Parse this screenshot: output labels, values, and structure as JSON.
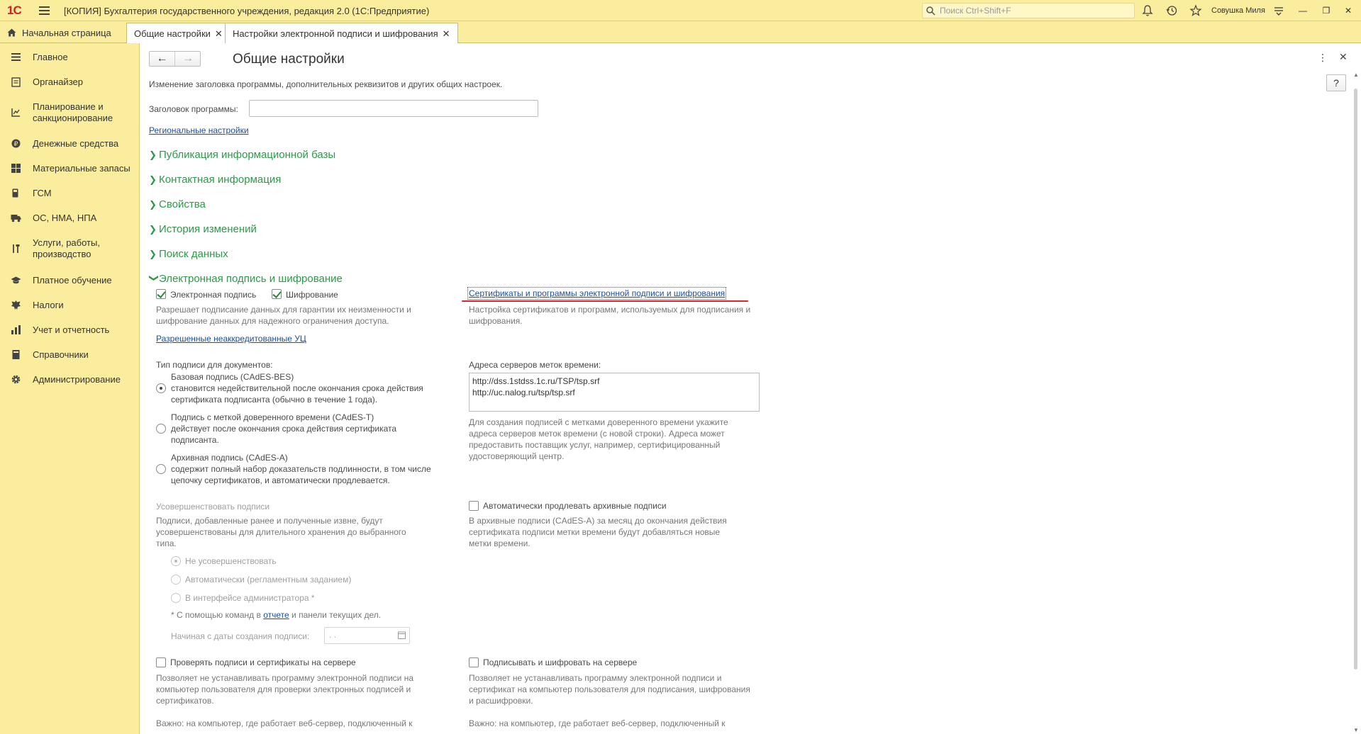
{
  "app": {
    "logo": "1С",
    "title": "[КОПИЯ] Бухгалтерия государственного учреждения, редакция 2.0  (1С:Предприятие)",
    "search_placeholder": "Поиск Ctrl+Shift+F",
    "user_name": "Совушка Миля"
  },
  "tabs": [
    {
      "label": "Начальная страница"
    },
    {
      "label": "Общие настройки"
    },
    {
      "label": "Настройки электронной подписи и шифрования"
    }
  ],
  "sidebar": {
    "items": [
      {
        "label": "Главное",
        "icon": "menu-lines-icon"
      },
      {
        "label": "Органайзер",
        "icon": "calendar-icon"
      },
      {
        "label": "Планирование и санкционирование",
        "icon": "planning-icon"
      },
      {
        "label": "Денежные средства",
        "icon": "coins-icon"
      },
      {
        "label": "Материальные запасы",
        "icon": "grid-icon"
      },
      {
        "label": "ГСМ",
        "icon": "fuel-icon"
      },
      {
        "label": "ОС, НМА, НПА",
        "icon": "truck-icon"
      },
      {
        "label": "Услуги, работы, производство",
        "icon": "tools-icon"
      },
      {
        "label": "Платное обучение",
        "icon": "graduation-cap-icon"
      },
      {
        "label": "Налоги",
        "icon": "emblem-icon"
      },
      {
        "label": "Учет и отчетность",
        "icon": "chart-icon"
      },
      {
        "label": "Справочники",
        "icon": "book-icon"
      },
      {
        "label": "Администрирование",
        "icon": "gear-icon"
      }
    ]
  },
  "main": {
    "title": "Общие настройки",
    "help": "?",
    "subtitle": "Изменение заголовка программы, дополнительных реквизитов и других общих настроек.",
    "program_title_label": "Заголовок программы:",
    "program_title_value": "",
    "regional_link": "Региональные настройки",
    "groups": [
      {
        "label": "Публикация информационной базы",
        "expanded": false
      },
      {
        "label": "Контактная информация",
        "expanded": false
      },
      {
        "label": "Свойства",
        "expanded": false
      },
      {
        "label": "История изменений",
        "expanded": false
      },
      {
        "label": "Поиск данных",
        "expanded": false
      },
      {
        "label": "Электронная подпись и шифрование",
        "expanded": true
      }
    ],
    "esig": {
      "cb_signature": "Электронная подпись",
      "cb_encryption": "Шифрование",
      "cb_desc_1": "Разрешает подписание данных для гарантии их неизменности и",
      "cb_desc_2": "шифрование данных для надежного ограничения доступа.",
      "allowed_ca_link": "Разрешенные неаккредитованные УЦ",
      "certs_link": "Сертификаты и программы электронной подписи и шифрования",
      "certs_desc_1": "Настройка сертификатов и программ, используемых для подписания и",
      "certs_desc_2": "шифрования.",
      "sig_type_label": "Тип подписи для документов:",
      "sig_types": [
        {
          "title": "Базовая подпись (CAdES-BES)",
          "desc1": "становится недействительной после окончания срока действия",
          "desc2": "сертификата подписанта (обычно в течение 1 года).",
          "selected": true
        },
        {
          "title": "Подпись с меткой доверенного времени (CAdES-T)",
          "desc1": "действует после окончания срока действия сертификата",
          "desc2": "подписанта.",
          "selected": false
        },
        {
          "title": "Архивная подпись (CAdES-A)",
          "desc1": "содержит полный набор доказательств подлинности, в том числе",
          "desc2": "цепочку сертификатов, и автоматически продлевается.",
          "selected": false
        }
      ],
      "tsa_label": "Адреса серверов меток времени:",
      "tsa_line1": "http://dss.1stdss.1c.ru/TSP/tsp.srf",
      "tsa_line2": "http://uc.nalog.ru/tsp/tsp.srf",
      "tsa_desc_1": "Для создания подписей с метками доверенного времени укажите",
      "tsa_desc_2": "адреса серверов меток времени (с новой строки). Адреса может",
      "tsa_desc_3": "предоставить поставщик услуг, например, сертифицированный",
      "tsa_desc_4": "удостоверяющий центр.",
      "improve_label": "Усовершенствовать подписи",
      "improve_desc_1": "Подписи, добавленные ранее и полученные извне, будут",
      "improve_desc_2": "усовершенствованы для длительного хранения до выбранного",
      "improve_desc_3": "типа.",
      "improve_opts": [
        "Не усовершенствовать",
        "Автоматически (регламентным заданием)",
        "В интерфейсе администратора *"
      ],
      "footnote_pre": "* С помощью команд в",
      "footnote_link": "отчете",
      "footnote_post": "и панели текущих дел.",
      "start_date_label": "Начиная с даты создания подписи:",
      "start_date_value": " .  .",
      "auto_extend_label": "Автоматически продлевать архивные подписи",
      "auto_extend_desc_1": "В архивные подписи (CAdES-A) за месяц до окончания действия",
      "auto_extend_desc_2": "сертификата подписи метки времени будут добавляться новые",
      "auto_extend_desc_3": "метки времени.",
      "verify_server_label": "Проверять подписи и сертификаты на сервере",
      "verify_desc_1": "Позволяет не устанавливать программу электронной подписи на",
      "verify_desc_2": "компьютер пользователя для проверки электронных подписей и",
      "verify_desc_3": "сертификатов.",
      "sign_server_label": "Подписывать и шифровать на сервере",
      "sign_desc_1": "Позволяет не устанавливать программу электронной подписи и",
      "sign_desc_2": "сертификат на компьютер пользователя для подписания, шифрования",
      "sign_desc_3": "и расшифровки.",
      "important_left": "Важно: на компьютер, где работает веб-сервер, подключенный к",
      "important_right": "Важно: на компьютер, где работает веб-сервер, подключенный к"
    }
  },
  "colors": {
    "panel": "#fbed9e",
    "group_green": "#2c9a47",
    "link_blue": "#1c4ea3",
    "annotation_red": "#e0242a"
  }
}
